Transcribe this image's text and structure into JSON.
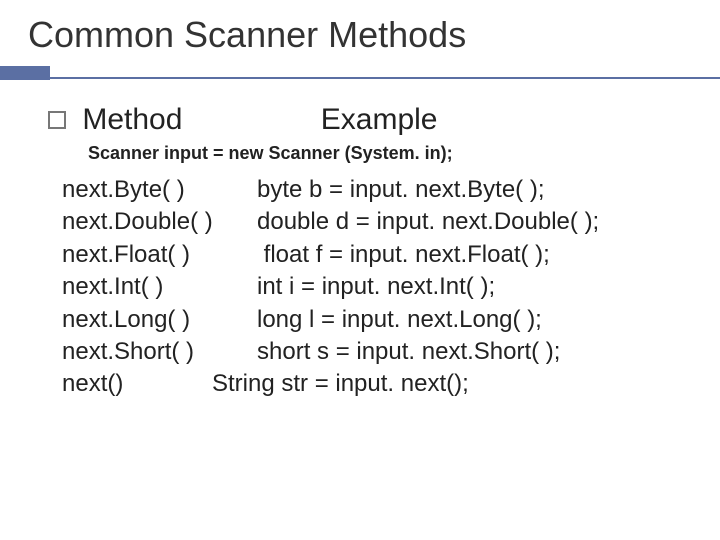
{
  "title": "Common Scanner Methods",
  "headers": {
    "method": "Method",
    "example": "Example"
  },
  "declaration": "Scanner input = new Scanner (System. in);",
  "rows": [
    {
      "method": "next.Byte( )",
      "example": "byte b = input. next.Byte( );"
    },
    {
      "method": "next.Double( )",
      "example": "double d = input. next.Double( );"
    },
    {
      "method": "next.Float( )",
      "example": " float f = input. next.Float( );"
    },
    {
      "method": "next.Int( )",
      "example": "int i = input. next.Int( );"
    },
    {
      "method": "next.Long( )",
      "example": "long l = input. next.Long( );"
    },
    {
      "method": "next.Short( )",
      "example": "short s = input. next.Short( );"
    },
    {
      "method": "next()",
      "example": "String str = input. next();"
    }
  ]
}
